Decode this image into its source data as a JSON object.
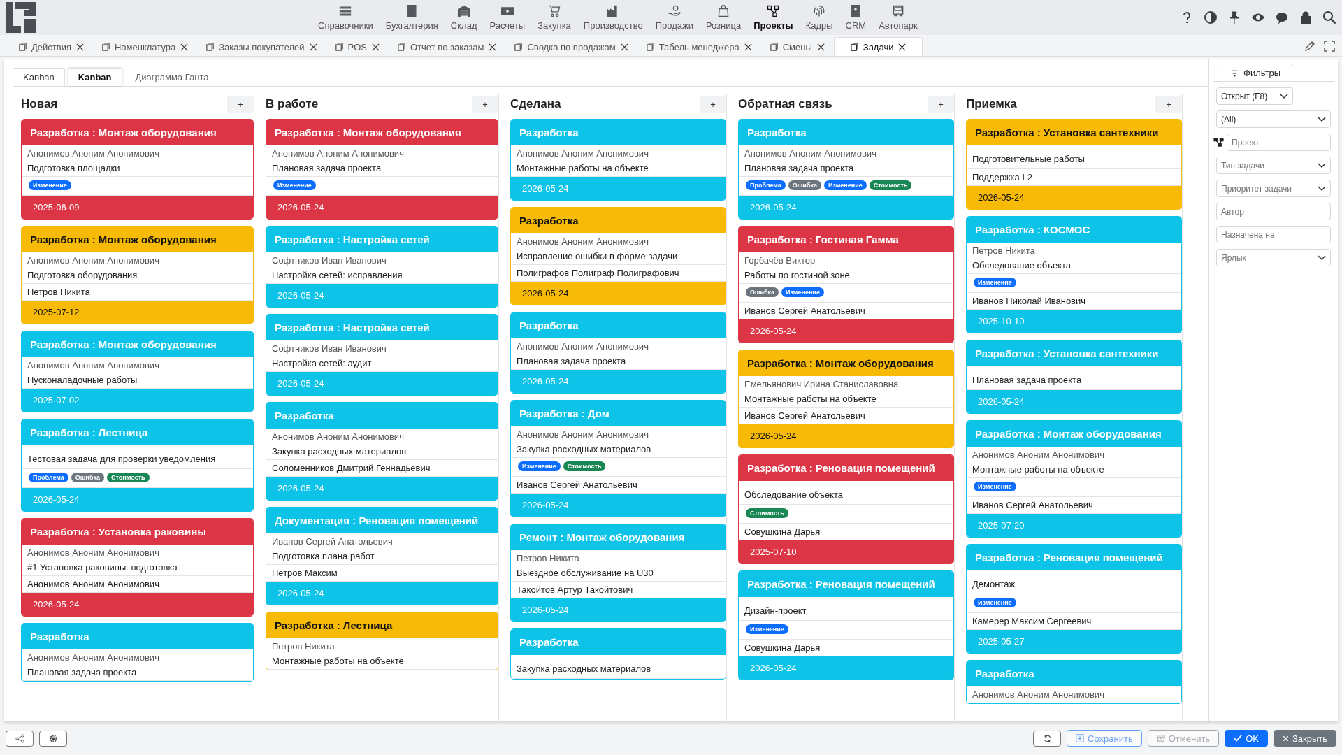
{
  "nav": [
    {
      "label": "Справочники",
      "selected": false
    },
    {
      "label": "Бухгалтерия",
      "selected": false
    },
    {
      "label": "Склад",
      "selected": false
    },
    {
      "label": "Расчеты",
      "selected": false
    },
    {
      "label": "Закупка",
      "selected": false
    },
    {
      "label": "Производство",
      "selected": false
    },
    {
      "label": "Продажи",
      "selected": false
    },
    {
      "label": "Розница",
      "selected": false
    },
    {
      "label": "Проекты",
      "selected": true
    },
    {
      "label": "Кадры",
      "selected": false
    },
    {
      "label": "CRM",
      "selected": false
    },
    {
      "label": "Автопарк",
      "selected": false
    }
  ],
  "tabs": [
    {
      "label": "Действия",
      "selected": false
    },
    {
      "label": "Номенклатура",
      "selected": false
    },
    {
      "label": "Заказы покупателей",
      "selected": false
    },
    {
      "label": "POS",
      "selected": false
    },
    {
      "label": "Отчет по заказам",
      "selected": false
    },
    {
      "label": "Сводка по продажам",
      "selected": false
    },
    {
      "label": "Табель менеджера",
      "selected": false
    },
    {
      "label": "Смены",
      "selected": false
    },
    {
      "label": "Задачи",
      "selected": true
    }
  ],
  "view_tabs": [
    {
      "label": "Kanban",
      "selected": false
    },
    {
      "label": "Kanban",
      "selected": true
    },
    {
      "label": "Диаграмма Ганта",
      "selected": false
    }
  ],
  "columns": [
    {
      "title": "Новая",
      "add": "+",
      "cards": [
        {
          "title": "Разработка : Монтаж оборудования",
          "color": "#dc3545",
          "author": "Анонимов Аноним Анонимович",
          "task": "Подготовка площадки",
          "tags": [
            {
              "label": "Изменение",
              "color": "#0d6efd"
            }
          ],
          "date": "2025-06-09"
        },
        {
          "title": "Разработка : Монтаж оборудования",
          "color": "#f7bb07",
          "author": "Анонимов Аноним Анонимович",
          "task": "Подготовка оборудования",
          "assignee": "Петров Никита",
          "date": "2025-07-12"
        },
        {
          "title": "Разработка : Монтаж оборудования",
          "color": "#0dc3e8",
          "author": "Анонимов Аноним Анонимович",
          "task": "Пусконаладочные работы",
          "date": "2025-07-02"
        },
        {
          "title": "Разработка : Лестница",
          "color": "#0dc3e8",
          "task": "Тестовая задача для проверки уведомления",
          "tags": [
            {
              "label": "Проблема",
              "color": "#0d6efd"
            },
            {
              "label": "Ошибка",
              "color": "#6c757d"
            },
            {
              "label": "Стоимость",
              "color": "#198754"
            }
          ],
          "date": "2026-05-24"
        },
        {
          "title": "Разработка : Установка раковины",
          "color": "#dc3545",
          "author": "Анонимов Аноним Анонимович",
          "task": "#1 Установка раковины: подготовка",
          "assignee": "Анонимов Аноним Анонимович",
          "date": "2026-05-24"
        },
        {
          "title": "Разработка",
          "color": "#0dc3e8",
          "author": "Анонимов Аноним Анонимович",
          "task": "Плановая задача проекта"
        }
      ]
    },
    {
      "title": "В работе",
      "add": "+",
      "cards": [
        {
          "title": "Разработка : Монтаж оборудования",
          "color": "#dc3545",
          "author": "Анонимов Аноним Анонимович",
          "task": "Плановая задача проекта",
          "tags": [
            {
              "label": "Изменение",
              "color": "#0d6efd"
            }
          ],
          "date": "2026-05-24"
        },
        {
          "title": "Разработка : Настройка сетей",
          "color": "#0dc3e8",
          "author": "Софтников Иван Иванович",
          "task": "Настройка сетей: исправления",
          "date": "2026-05-24"
        },
        {
          "title": "Разработка : Настройка сетей",
          "color": "#0dc3e8",
          "author": "Софтников Иван Иванович",
          "task": "Настройка сетей: аудит",
          "date": "2026-05-24"
        },
        {
          "title": "Разработка",
          "color": "#0dc3e8",
          "author": "Анонимов Аноним Анонимович",
          "task": "Закупка расходных материалов",
          "assignee": "Соломенников Дмитрий Геннадьевич",
          "date": "2026-05-24"
        },
        {
          "title": "Документация : Реновация помещений",
          "color": "#0dc3e8",
          "author": "Иванов Сергей Анатольевич",
          "task": "Подготовка плана работ",
          "assignee": "Петров Максим",
          "date": "2026-05-24"
        },
        {
          "title": "Разработка : Лестница",
          "color": "#f7bb07",
          "author": "Петров Никита",
          "task": "Монтажные работы на объекте"
        }
      ]
    },
    {
      "title": "Сделана",
      "add": "+",
      "cards": [
        {
          "title": "Разработка",
          "color": "#0dc3e8",
          "author": "Анонимов Аноним Анонимович",
          "task": "Монтажные работы на объекте",
          "date": "2026-05-24"
        },
        {
          "title": "Разработка",
          "color": "#f7bb07",
          "author": "Анонимов Аноним Анонимович",
          "task": "Исправление ошибки в форме задачи",
          "assignee": "Полиграфов Полиграф Полиграфович",
          "date": "2026-05-24"
        },
        {
          "title": "Разработка",
          "color": "#0dc3e8",
          "author": "Анонимов Аноним Анонимович",
          "task": "Плановая задача проекта",
          "date": "2026-05-24"
        },
        {
          "title": "Разработка : Дом",
          "color": "#0dc3e8",
          "author": "Анонимов Аноним Анонимович",
          "task": "Закупка расходных материалов",
          "tags": [
            {
              "label": "Изменение",
              "color": "#0d6efd"
            },
            {
              "label": "Стоимость",
              "color": "#198754"
            }
          ],
          "assignee": "Иванов Сергей Анатольевич",
          "date": "2026-05-24"
        },
        {
          "title": "Ремонт : Монтаж оборудования",
          "color": "#0dc3e8",
          "author": "Петров Никита",
          "task": "Выездное обслуживание на U30",
          "assignee": "Такойтов Артур Такойтович",
          "date": "2026-05-24"
        },
        {
          "title": "Разработка",
          "color": "#0dc3e8",
          "task": "Закупка расходных материалов"
        }
      ]
    },
    {
      "title": "Обратная связь",
      "add": "+",
      "cards": [
        {
          "title": "Разработка",
          "color": "#0dc3e8",
          "author": "Анонимов Аноним Анонимович",
          "task": "Плановая задача проекта",
          "tags": [
            {
              "label": "Проблема",
              "color": "#0d6efd"
            },
            {
              "label": "Ошибка",
              "color": "#6c757d"
            },
            {
              "label": "Изменение",
              "color": "#0d6efd"
            },
            {
              "label": "Стоимость",
              "color": "#198754"
            }
          ],
          "date": "2026-05-24"
        },
        {
          "title": "Разработка : Гостиная Гамма",
          "color": "#dc3545",
          "author": "Горбачёв Виктор",
          "task": "Работы по гостиной зоне",
          "tags": [
            {
              "label": "Ошибка",
              "color": "#6c757d"
            },
            {
              "label": "Изменение",
              "color": "#0d6efd"
            }
          ],
          "assignee": "Иванов Сергей Анатольевич",
          "date": "2026-05-24"
        },
        {
          "title": "Разработка : Монтаж оборудования",
          "color": "#f7bb07",
          "author": "Емельянович Ирина Станиславовна",
          "task": "Монтажные работы на объекте",
          "assignee": "Иванов Сергей Анатольевич",
          "date": "2026-05-24"
        },
        {
          "title": "Разработка : Реновация помещений",
          "color": "#dc3545",
          "task": "Обследование объекта",
          "tags": [
            {
              "label": "Стоимость",
              "color": "#198754"
            }
          ],
          "assignee": "Совушкина Дарья",
          "date": "2025-07-10"
        },
        {
          "title": "Разработка : Реновация помещений",
          "color": "#0dc3e8",
          "task": "Дизайн-проект",
          "tags": [
            {
              "label": "Изменение",
              "color": "#0d6efd"
            }
          ],
          "assignee": "Совушкина Дарья",
          "date": "2026-05-24"
        }
      ]
    },
    {
      "title": "Приемка",
      "add": "+",
      "cards": [
        {
          "title": "Разработка : Установка сантехники",
          "color": "#f7bb07",
          "task": "Подготовительные работы",
          "assignee": "Поддержка L2",
          "date": "2026-05-24"
        },
        {
          "title": "Разработка : КОСМОС",
          "color": "#0dc3e8",
          "author": "Петров Никита",
          "task": "Обследование объекта",
          "tags": [
            {
              "label": "Изменение",
              "color": "#0d6efd"
            }
          ],
          "assignee": "Иванов Николай Иванович",
          "date": "2025-10-10"
        },
        {
          "title": "Разработка : Установка сантехники",
          "color": "#0dc3e8",
          "task": "Плановая задача проекта",
          "date": "2026-05-24"
        },
        {
          "title": "Разработка : Монтаж оборудования",
          "color": "#0dc3e8",
          "author": "Анонимов Аноним Анонимович",
          "task": "Монтажные работы на объекте",
          "tags": [
            {
              "label": "Изменение",
              "color": "#0d6efd"
            }
          ],
          "assignee": "Иванов Сергей Анатольевич",
          "date": "2025-07-20"
        },
        {
          "title": "Разработка : Реновация помещений",
          "color": "#0dc3e8",
          "task": "Демонтаж",
          "tags": [
            {
              "label": "Изменение",
              "color": "#0d6efd"
            }
          ],
          "assignee": "Камерер Максим Сергеевич",
          "date": "2025-05-27"
        },
        {
          "title": "Разработка",
          "color": "#0dc3e8",
          "author": "Анонимов Аноним Анонимович"
        }
      ]
    }
  ],
  "filters": {
    "tab": "Фильтры",
    "fields": [
      {
        "kind": "select",
        "value": "Открыт (F8)"
      },
      {
        "kind": "select",
        "value": "(All)"
      },
      {
        "kind": "project",
        "placeholder": "Проект"
      },
      {
        "kind": "select",
        "placeholder": "Тип задачи"
      },
      {
        "kind": "select",
        "placeholder": "Приоритет задачи"
      },
      {
        "kind": "input",
        "placeholder": "Автор"
      },
      {
        "kind": "input",
        "placeholder": "Назначена на"
      },
      {
        "kind": "select",
        "placeholder": "Ярлык"
      }
    ]
  },
  "footer_buttons": [
    {
      "label": "Сохранить",
      "kind": "outline-primary",
      "disabled": true
    },
    {
      "label": "Отменить",
      "kind": "outline-secondary",
      "disabled": true
    },
    {
      "label": "OK",
      "kind": "primary",
      "disabled": false
    },
    {
      "label": "Закрыть",
      "kind": "secondary",
      "disabled": false
    }
  ]
}
